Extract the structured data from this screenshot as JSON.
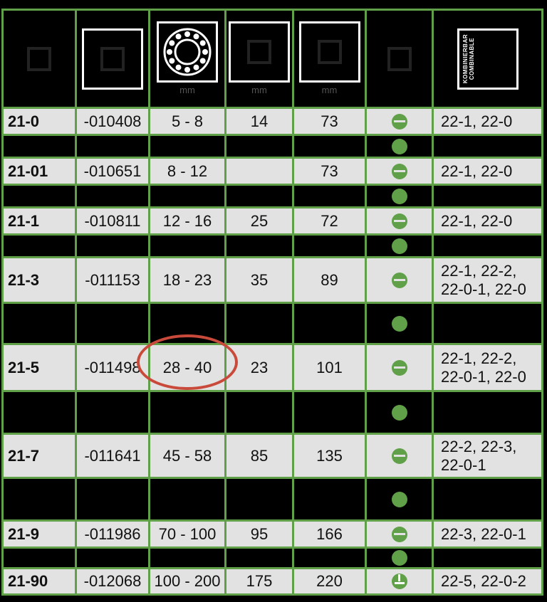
{
  "header": {
    "col0_icon": "article-number-icon",
    "col1_icon": "ruler-icon",
    "col2_icon": "bearing-icon",
    "col2_unit": "mm",
    "col3_icon": "width-icon",
    "col3_unit": "mm",
    "col4_icon": "length-icon",
    "col4_unit": "mm",
    "col5_icon": "type-icon",
    "col6_label_1": "KOMBINIERBAR",
    "col6_label_2": "COMBINABLE"
  },
  "rows": [
    {
      "id": "21-0",
      "code": "-010408",
      "range": "5 - 8",
      "w": "14",
      "l": "73",
      "dot": "slot",
      "comb": "22-1, 22-0"
    },
    {
      "id": "",
      "code": "",
      "range": "",
      "w": "",
      "l": "",
      "dot": "plain",
      "comb": ""
    },
    {
      "id": "21-01",
      "code": "-010651",
      "range": "8 - 12",
      "w": "",
      "l": "73",
      "dot": "slot",
      "comb": "22-1, 22-0"
    },
    {
      "id": "",
      "code": "",
      "range": "",
      "w": "",
      "l": "",
      "dot": "plain",
      "comb": ""
    },
    {
      "id": "21-1",
      "code": "-010811",
      "range": "12 - 16",
      "w": "25",
      "l": "72",
      "dot": "slot",
      "comb": "22-1, 22-0"
    },
    {
      "id": "",
      "code": "",
      "range": "",
      "w": "",
      "l": "",
      "dot": "plain",
      "comb": ""
    },
    {
      "id": "21-3",
      "code": "-011153",
      "range": "18 - 23",
      "w": "35",
      "l": "89",
      "dot": "slot",
      "comb": "22-1, 22-2, 22-0-1, 22-0"
    },
    {
      "id": "",
      "code": "",
      "range": "",
      "w": "",
      "l": "",
      "dot": "plain",
      "comb": ""
    },
    {
      "id": "21-5",
      "code": "-011498",
      "range": "28 - 40",
      "w": "23",
      "l": "101",
      "dot": "slot",
      "comb": "22-1, 22-2, 22-0-1, 22-0"
    },
    {
      "id": "",
      "code": "",
      "range": "",
      "w": "",
      "l": "",
      "dot": "plain",
      "comb": ""
    },
    {
      "id": "21-7",
      "code": "-011641",
      "range": "45 - 58",
      "w": "85",
      "l": "135",
      "dot": "slot",
      "comb": "22-2, 22-3, 22-0-1"
    },
    {
      "id": "",
      "code": "",
      "range": "",
      "w": "",
      "l": "",
      "dot": "plain",
      "comb": ""
    },
    {
      "id": "21-9",
      "code": "-011986",
      "range": "70 - 100",
      "w": "95",
      "l": "166",
      "dot": "slot",
      "comb": "22-3, 22-0-1"
    },
    {
      "id": "",
      "code": "",
      "range": "",
      "w": "",
      "l": "",
      "dot": "plain",
      "comb": ""
    },
    {
      "id": "21-90",
      "code": "-012068",
      "range": "100 - 200",
      "w": "175",
      "l": "220",
      "dot": "tri",
      "comb": "22-5, 22-0-2"
    }
  ]
}
